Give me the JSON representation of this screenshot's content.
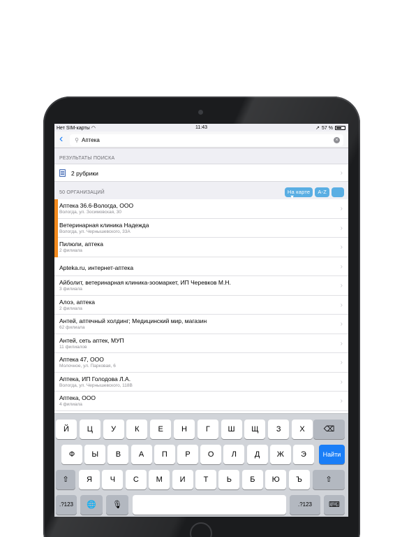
{
  "status": {
    "carrier": "Нет SIM-карты",
    "time": "11:43",
    "battery": "57 %",
    "battery_level": 0.57
  },
  "search": {
    "query": "Аптека",
    "placeholder": ""
  },
  "results_header": "РЕЗУЛЬТАТЫ ПОИСКА",
  "rubrics_label": "2 рубрики",
  "orgs_header": "50 ОРГАНИЗАЦИЙ",
  "buttons": {
    "map": "На карте",
    "az": "A-Z"
  },
  "organizations": [
    {
      "title": "Аптека 36.6-Вологда, ООО",
      "sub": "Вологда, ул. Зосимовская, 30",
      "promo": true
    },
    {
      "title": "Ветеринарная клиника Надежда",
      "sub": "Вологда, ул. Чернышевского, 33А",
      "promo": true
    },
    {
      "title": "Пилюли, аптека",
      "sub": "2 филиала",
      "promo": true
    },
    {
      "title": "Apteka.ru, интернет-аптека",
      "sub": "",
      "promo": false
    },
    {
      "title": "Айболит, ветеринарная клиника-зоомаркет, ИП Черевков М.Н.",
      "sub": "3 филиала",
      "promo": false
    },
    {
      "title": "Алоэ, аптека",
      "sub": "2 филиала",
      "promo": false
    },
    {
      "title": "Антей, аптечный холдинг; Медицинский мир, магазин",
      "sub": "62 филиала",
      "promo": false
    },
    {
      "title": "Антей, сеть аптек, МУП",
      "sub": "11 филиалов",
      "promo": false
    },
    {
      "title": "Аптека 47, ООО",
      "sub": "Молочное, ул. Парковая, 6",
      "promo": false
    },
    {
      "title": "Аптека, ИП Голодова Л.А.",
      "sub": "Вологда, ул. Чернышевского, 118В",
      "promo": false
    },
    {
      "title": "Аптека, ООО",
      "sub": "4 филиала",
      "promo": false
    }
  ],
  "keyboard": {
    "row1": [
      "Й",
      "Ц",
      "У",
      "К",
      "Е",
      "Н",
      "Г",
      "Ш",
      "Щ",
      "З",
      "Х"
    ],
    "row2": [
      "Ф",
      "Ы",
      "В",
      "А",
      "П",
      "Р",
      "О",
      "Л",
      "Д",
      "Ж",
      "Э"
    ],
    "row3": [
      "Я",
      "Ч",
      "С",
      "М",
      "И",
      "Т",
      "Ь",
      "Б",
      "Ю",
      "Ъ"
    ],
    "numbers_label": ".?123",
    "go_label": "Найти"
  }
}
